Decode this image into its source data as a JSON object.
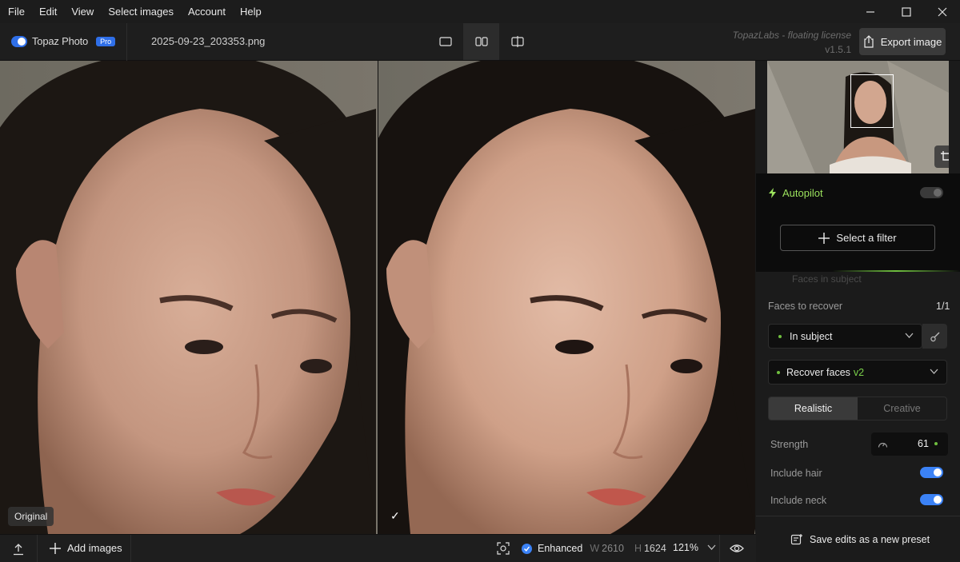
{
  "menu": [
    "File",
    "Edit",
    "View",
    "Select images",
    "Account",
    "Help"
  ],
  "toolbar": {
    "logo_text": "Topaz Photo",
    "pro_badge": "Pro",
    "filename": "2025-09-23_203353.png",
    "license": "TopazLabs - floating license",
    "version": "v1.5.1",
    "export_label": "Export image"
  },
  "view_modes": [
    "single-view",
    "side-by-side-view",
    "split-view"
  ],
  "active_view": "side-by-side-view",
  "canvas": {
    "original_label": "Original",
    "enhanced_check": "✓"
  },
  "panel": {
    "autopilot_label": "Autopilot",
    "select_filter_label": "Select a filter",
    "faded_text": "Faces in subject",
    "faces_label": "Faces to recover",
    "faces_count": "1/1",
    "subject_dropdown": "In subject",
    "recover_label": "Recover faces",
    "recover_version": "v2",
    "mode_options": [
      "Realistic",
      "Creative"
    ],
    "mode_selected": "Realistic",
    "strength_label": "Strength",
    "strength_value": "61",
    "include_hair_label": "Include hair",
    "include_hair": true,
    "include_neck_label": "Include neck",
    "include_neck": true,
    "save_preset_label": "Save edits as a new preset"
  },
  "bottombar": {
    "add_images_label": "Add images",
    "enhanced_label": "Enhanced",
    "w_label": "W",
    "w_value": "2610",
    "h_label": "H",
    "h_value": "1624",
    "zoom": "121%"
  },
  "colors": {
    "accent_blue": "#3b82f6",
    "accent_green": "#7bd14a",
    "bg_dark": "#1b1b1b"
  }
}
